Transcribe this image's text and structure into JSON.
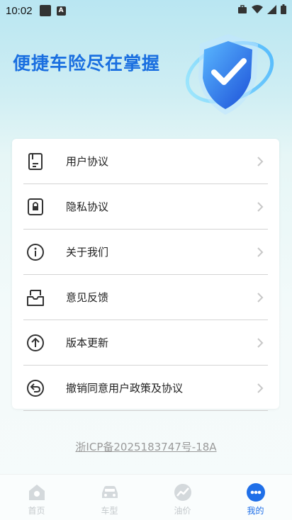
{
  "status_bar": {
    "time": "10:02"
  },
  "hero": {
    "title": "便捷车险尽在掌握"
  },
  "menu": [
    {
      "label": "用户协议",
      "icon": "document-icon"
    },
    {
      "label": "隐私协议",
      "icon": "lock-icon"
    },
    {
      "label": "关于我们",
      "icon": "info-icon"
    },
    {
      "label": "意见反馈",
      "icon": "feedback-icon"
    },
    {
      "label": "版本更新",
      "icon": "arrow-up-circle-icon"
    },
    {
      "label": "撤销同意用户政策及协议",
      "icon": "undo-circle-icon"
    }
  ],
  "footer": {
    "icp": "浙ICP备2025183747号-18A"
  },
  "tabs": [
    {
      "label": "首页",
      "icon": "home-icon",
      "active": false
    },
    {
      "label": "车型",
      "icon": "car-icon",
      "active": false
    },
    {
      "label": "油价",
      "icon": "oil-price-icon",
      "active": false
    },
    {
      "label": "我的",
      "icon": "profile-dots-icon",
      "active": true
    }
  ],
  "colors": {
    "accent": "#1f6fe8",
    "inactive_tab": "#c4c9cc",
    "title_blue": "#1a6fe0"
  }
}
